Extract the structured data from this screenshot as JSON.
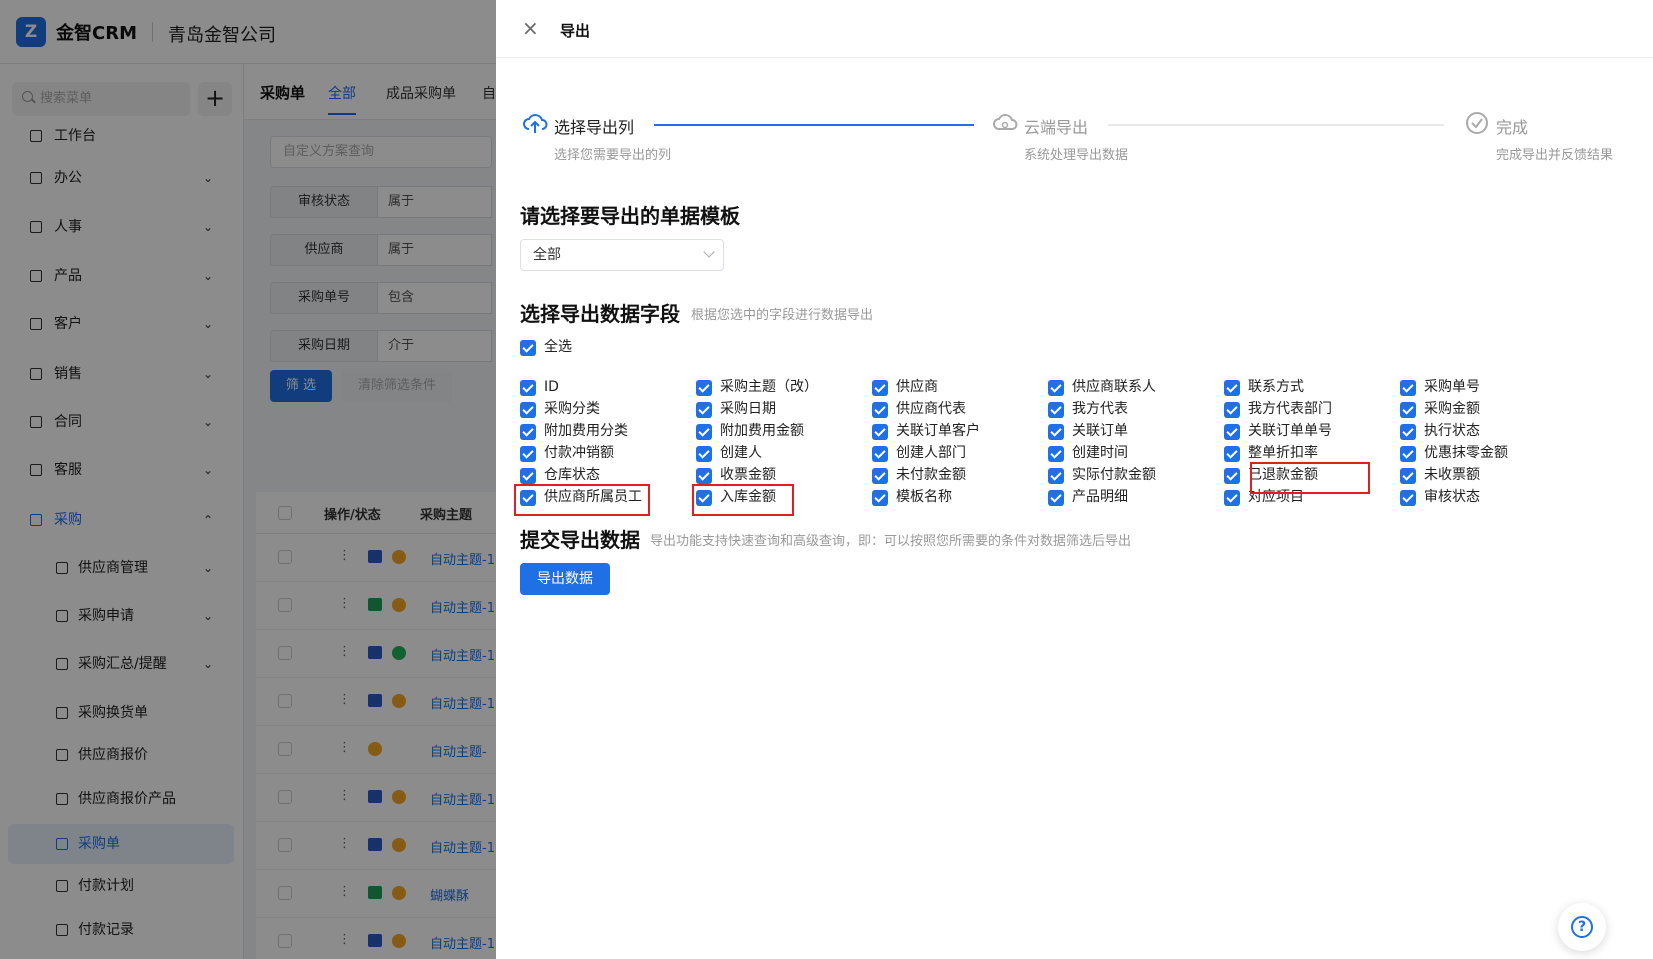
{
  "app": {
    "logo": "Z",
    "brand": "金智CRM",
    "company": "青岛金智公司"
  },
  "sidebar": {
    "search_placeholder": "搜索菜单",
    "add_label": "+",
    "items": [
      {
        "label": "工作台",
        "chev": ""
      },
      {
        "label": "办公",
        "chev": "⌄"
      },
      {
        "label": "人事",
        "chev": "⌄"
      },
      {
        "label": "产品",
        "chev": "⌄"
      },
      {
        "label": "客户",
        "chev": "⌄"
      },
      {
        "label": "销售",
        "chev": "⌄"
      },
      {
        "label": "合同",
        "chev": "⌄"
      },
      {
        "label": "客服",
        "chev": "⌄"
      },
      {
        "label": "采购",
        "chev": "⌃"
      },
      {
        "label": "供应商管理",
        "chev": "⌄"
      },
      {
        "label": "采购申请",
        "chev": "⌄"
      },
      {
        "label": "采购汇总/提醒",
        "chev": "⌄"
      },
      {
        "label": "采购换货单",
        "chev": ""
      },
      {
        "label": "供应商报价",
        "chev": ""
      },
      {
        "label": "供应商报价产品",
        "chev": ""
      },
      {
        "label": "采购单",
        "chev": ""
      },
      {
        "label": "付款计划",
        "chev": ""
      },
      {
        "label": "付款记录",
        "chev": ""
      }
    ]
  },
  "content": {
    "title": "采购单",
    "tabs": [
      "全部",
      "成品采购单",
      "自"
    ],
    "scheme_placeholder": "自定义方案查询",
    "filters": [
      {
        "label": "审核状态",
        "op": "属于"
      },
      {
        "label": "供应商",
        "op": "属于"
      },
      {
        "label": "采购单号",
        "op": "包含"
      },
      {
        "label": "采购日期",
        "op": "介于"
      }
    ],
    "filter_btn": "筛 选",
    "clear_btn": "清除筛选条件",
    "grid_headers": [
      "操作/状态",
      "采购主题"
    ],
    "rows": [
      "自动主题-1",
      "自动主题-1",
      "自动主题-1",
      "自动主题-1",
      "自动主题-",
      "自动主题-1",
      "自动主题-1",
      "蝴蝶酥",
      "自动主题-1"
    ]
  },
  "drawer": {
    "close": "×",
    "title": "导出",
    "steps": [
      {
        "label": "选择导出列",
        "sub": "选择您需要导出的列"
      },
      {
        "label": "云端导出",
        "sub": "系统处理导出数据"
      },
      {
        "label": "完成",
        "sub": "完成导出并反馈结果"
      }
    ],
    "template_heading": "请选择要导出的单据模板",
    "template_value": "全部",
    "fields_heading": "选择导出数据字段",
    "fields_hint": "根据您选中的字段进行数据导出",
    "select_all": "全选",
    "fields": [
      [
        "ID",
        "采购主题（改）",
        "供应商",
        "供应商联系人",
        "联系方式",
        "采购单号"
      ],
      [
        "采购分类",
        "采购日期",
        "供应商代表",
        "我方代表",
        "我方代表部门",
        "采购金额"
      ],
      [
        "附加费用分类",
        "附加费用金额",
        "关联订单客户",
        "关联订单",
        "关联订单单号",
        "执行状态"
      ],
      [
        "付款冲销额",
        "创建人",
        "创建人部门",
        "创建时间",
        "整单折扣率",
        "优惠抹零金额"
      ],
      [
        "仓库状态",
        "收票金额",
        "未付款金额",
        "实际付款金额",
        "已退款金额",
        "未收票额"
      ],
      [
        "供应商所属员工",
        "入库金额",
        "模板名称",
        "产品明细",
        "对应项目",
        "审核状态"
      ]
    ],
    "submit_heading": "提交导出数据",
    "submit_hint": "导出功能支持快速查询和高级查询，即：可以按照您所需要的条件对数据筛选后导出",
    "export_btn": "导出数据"
  },
  "help": "?",
  "colors": {
    "primary": "#1f6fe5",
    "highlight": "#e02020"
  }
}
